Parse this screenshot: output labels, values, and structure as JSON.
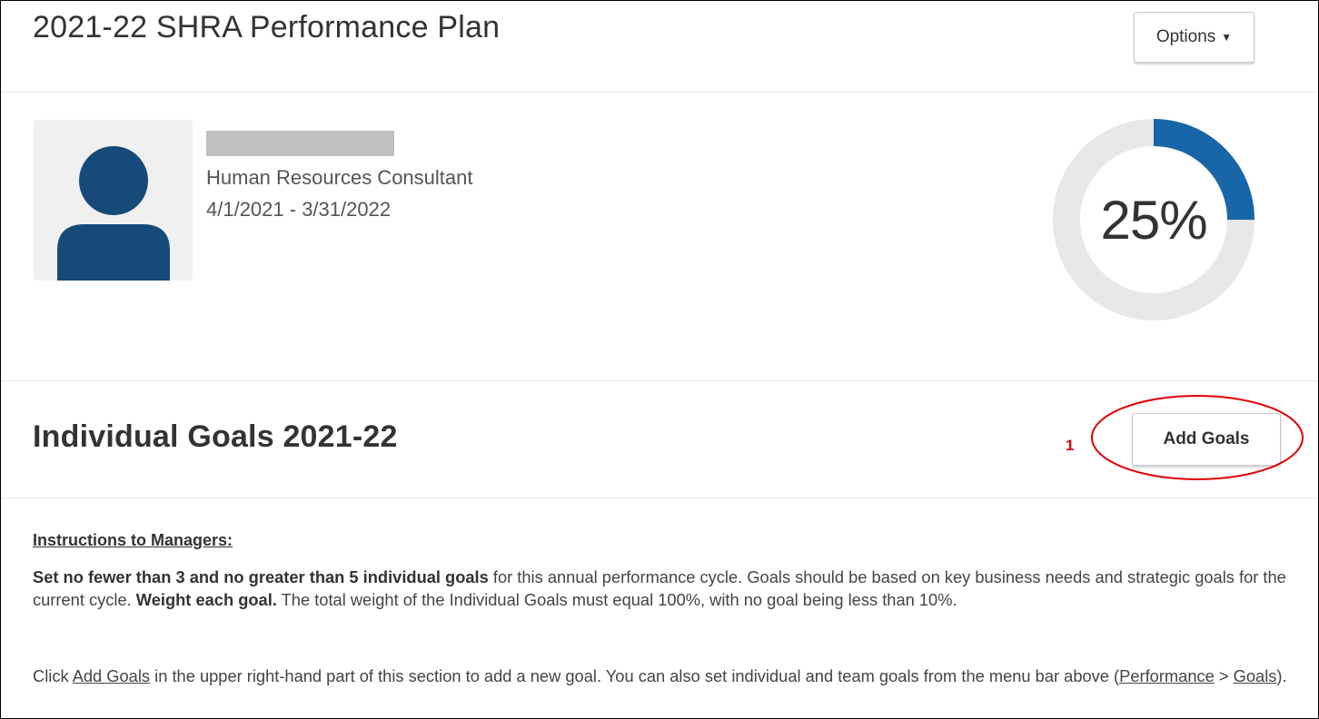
{
  "header": {
    "title": "2021-22 SHRA Performance Plan",
    "options_label": "Options",
    "options_caret": "▼"
  },
  "employee": {
    "job_title": "Human Resources Consultant",
    "date_range": "4/1/2021 - 3/31/2022",
    "avatar_icon": "person-icon",
    "avatar_color": "#164a78"
  },
  "progress": {
    "value": 0.25,
    "label": "25%",
    "fill_color": "#1866a7",
    "track_color": "#e8e8e8"
  },
  "goals_section": {
    "title": "Individual Goals 2021-22",
    "add_goals_label": "Add Goals",
    "annotation_number": "1",
    "annotation_color": "#e00000"
  },
  "instructions": {
    "heading": "Instructions to Managers:",
    "p1_bold1": "Set no fewer than 3 and no greater than 5 individual goals",
    "p1_text1": " for this annual performance cycle. Goals should be based on key business needs and strategic goals for the current cycle. ",
    "p1_bold2": "Weight each goal.",
    "p1_text2": " The total weight of the Individual Goals must equal 100%, with no goal being less than 10%.",
    "p2_text1": "Click ",
    "p2_link1": "Add Goals",
    "p2_text2": " in the upper right-hand part of this section to add a new goal. You can also set individual and team goals from the menu bar above (",
    "p2_link2": "Performance",
    "p2_text3": " > ",
    "p2_link3": "Goals",
    "p2_text4": ")."
  }
}
